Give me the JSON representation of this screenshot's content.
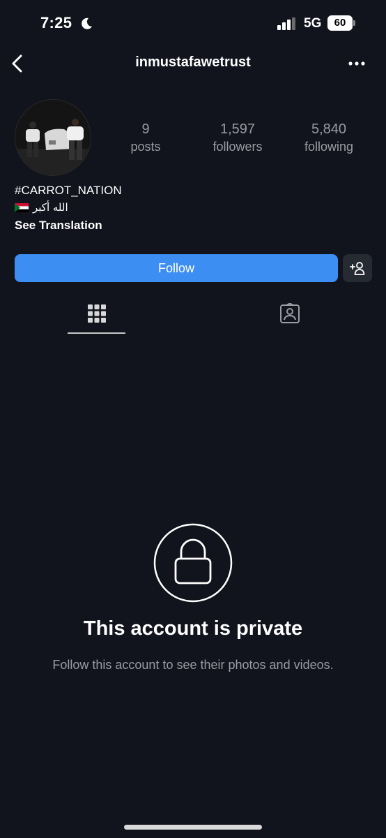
{
  "status_bar": {
    "time": "7:25",
    "network": "5G",
    "battery": "60"
  },
  "header": {
    "username": "inmustafawetrust"
  },
  "profile": {
    "stats": [
      {
        "value": "9",
        "label": "posts"
      },
      {
        "value": "1,597",
        "label": "followers"
      },
      {
        "value": "5,840",
        "label": "following"
      }
    ],
    "bio_name": "#CARROT_NATION",
    "bio_line": "الله أكبر",
    "see_translation": "See Translation"
  },
  "actions": {
    "follow_label": "Follow"
  },
  "private": {
    "title": "This account is private",
    "subtitle": "Follow this account to see their photos and videos."
  },
  "colors": {
    "background": "#11131d",
    "accent": "#3d8ef2",
    "secondary_text": "#9a9ca3"
  },
  "icons": {
    "back": "chevron-left-icon",
    "more": "more-horizontal-icon",
    "suggest": "add-person-icon",
    "grid_tab": "grid-icon",
    "tagged_tab": "tagged-person-icon",
    "private": "lock-icon"
  }
}
